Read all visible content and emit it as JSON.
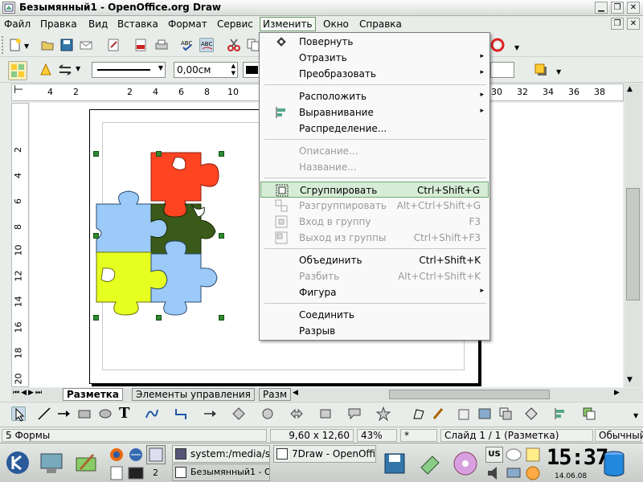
{
  "window": {
    "title": "Безымянный1 - OpenOffice.org Draw"
  },
  "menubar": {
    "items": [
      "Файл",
      "Правка",
      "Вид",
      "Вставка",
      "Формат",
      "Сервис",
      "Изменить",
      "Окно",
      "Справка"
    ],
    "active": "Изменить"
  },
  "toolbar2": {
    "line_width": "0,00см"
  },
  "ruler": {
    "h_ticks": [
      "4",
      "2",
      "2",
      "4",
      "6",
      "8",
      "10",
      "30",
      "32",
      "34",
      "36",
      "38"
    ],
    "v_ticks": [
      "2",
      "4",
      "6",
      "8",
      "10",
      "12",
      "14",
      "16",
      "18",
      "20"
    ]
  },
  "menu": {
    "items": [
      {
        "label": "Повернуть",
        "icon": "rotate-icon"
      },
      {
        "label": "Отразить",
        "submenu": true
      },
      {
        "label": "Преобразовать",
        "submenu": true
      },
      {
        "label": "Расположить",
        "submenu": true
      },
      {
        "label": "Выравнивание",
        "submenu": true,
        "icon": "align-icon"
      },
      {
        "label": "Распределение..."
      },
      {
        "label": "Описание...",
        "disabled": true
      },
      {
        "label": "Название...",
        "disabled": true
      },
      {
        "label": "Сгруппировать",
        "shortcut": "Ctrl+Shift+G",
        "highlighted": true,
        "icon": "group-icon"
      },
      {
        "label": "Разгруппировать",
        "shortcut": "Alt+Ctrl+Shift+G",
        "disabled": true,
        "icon": "ungroup-icon"
      },
      {
        "label": "Вход в группу",
        "shortcut": "F3",
        "disabled": true,
        "icon": "enter-group-icon"
      },
      {
        "label": "Выход из группы",
        "shortcut": "Ctrl+Shift+F3",
        "disabled": true,
        "icon": "exit-group-icon"
      },
      {
        "label": "Объединить",
        "shortcut": "Ctrl+Shift+K"
      },
      {
        "label": "Разбить",
        "shortcut": "Alt+Ctrl+Shift+K",
        "disabled": true
      },
      {
        "label": "Фигура",
        "submenu": true
      },
      {
        "label": "Соединить"
      },
      {
        "label": "Разрыв"
      }
    ]
  },
  "tabs": [
    "Разметка",
    "Элементы управления",
    "Разм"
  ],
  "status": {
    "shapes": "5 Формы",
    "size": "9,60 x 12,60",
    "zoom": "43%",
    "modified": "*",
    "slide": "Слайд 1 / 1 (Разметка)",
    "style": "Обычный"
  },
  "taskbar": {
    "tasks": [
      "system:/media/sd",
      "7Draw - OpenOffic",
      "Безымянный1 - Оpen"
    ],
    "desktop_num": "2",
    "clock": "15:37",
    "date": "14.06.08",
    "lang": "US"
  },
  "colors": {
    "red": "#ff4422",
    "dark_green": "#3a5a1a",
    "light_blue": "#9ccaf8",
    "yellow": "#e6ff20",
    "highlight": "#d6ecd6"
  }
}
